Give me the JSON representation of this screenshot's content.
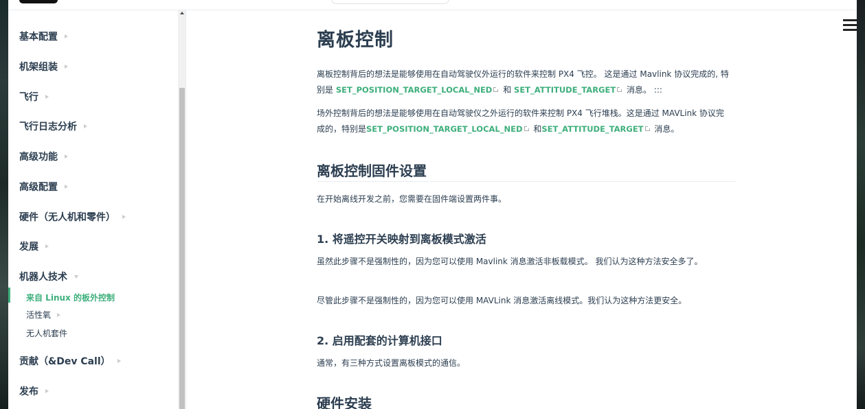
{
  "sidebar": {
    "items": [
      {
        "label": "基本配置",
        "expanded": false
      },
      {
        "label": "机架组装",
        "expanded": false
      },
      {
        "label": "飞行",
        "expanded": false
      },
      {
        "label": "飞行日志分析",
        "expanded": false
      },
      {
        "label": "高级功能",
        "expanded": false
      },
      {
        "label": "高级配置",
        "expanded": false
      },
      {
        "label": "硬件（无人机和零件）",
        "expanded": false
      },
      {
        "label": "发展",
        "expanded": false
      },
      {
        "label": "机器人技术",
        "expanded": true
      },
      {
        "label": "贡献（&Dev Call）",
        "expanded": false
      },
      {
        "label": "发布",
        "expanded": false
      }
    ],
    "sub_items": [
      {
        "label": "来自 Linux 的板外控制",
        "active": true
      },
      {
        "label": "活性氧",
        "has_children": true
      },
      {
        "label": "无人机套件",
        "has_children": false
      }
    ]
  },
  "article": {
    "title": "离板控制",
    "intro_p1": {
      "before": "离板控制背后的想法是能够使用在自动驾驶仪外运行的软件来控制 PX4 飞控。 这是通过 Mavlink 协议完成的, 特别是",
      "link1": "SET_POSITION_TARGET_LOCAL_NED",
      "mid": "和",
      "link2": "SET_ATTITUDE_TARGET",
      "after": "消息。 :::"
    },
    "intro_p2": {
      "before": "场外控制背后的想法是能够使用在自动驾驶仪之外运行的软件来控制 PX4 飞行堆栈。这是通过 MAVLink 协议完成的，特别是",
      "link1": "SET_POSITION_TARGET_LOCAL_NED",
      "mid": "和",
      "link2": "SET_ATTITUDE_TARGET",
      "after": "消息。"
    },
    "section1_title": "离板控制固件设置",
    "section1_text": "在开始离线开发之前，您需要在固件端设置两件事。",
    "step1_title": "1. 将遥控开关映射到离板模式激活",
    "step1_p1": "虽然此步骤不是强制性的，因为您可以使用 Mavlink 消息激活非板载模式。 我们认为这种方法安全多了。",
    "step1_p2": "尽管此步骤不是强制性的，因为您可以使用 MAVLink 消息激活离线模式。我们认为这种方法更安全。",
    "step2_title": "2. 启用配套的计算机接口",
    "step2_text": "通常，有三种方式设置离板模式的通信。",
    "section2_title": "硬件安装"
  },
  "colors": {
    "accent": "#3eaf7c",
    "text": "#2c3e50",
    "border": "#eaecef"
  },
  "icons": {
    "menu": "hamburger-menu-icon",
    "external_link": "external-link-icon",
    "expand_arrow": "chevron-right-icon"
  }
}
